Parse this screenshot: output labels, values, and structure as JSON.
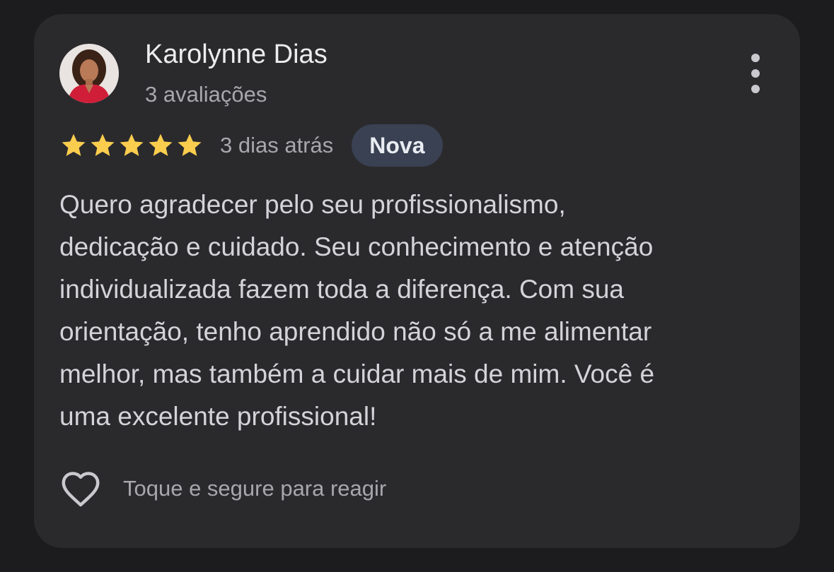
{
  "review": {
    "author_name": "Karolynne Dias",
    "review_count": "3 avaliações",
    "rating": 5,
    "rating_max": 5,
    "date": "3 dias atrás",
    "badge": "Nova",
    "text": "Quero agradecer pelo seu profissionalismo,\ndedicação e cuidado. Seu conhecimento e atenção\nindividualizada fazem toda a diferença. Com sua\norientação, tenho aprendido não só a me alimentar\nmelhor, mas também a cuidar mais de mim. Você é\numa excelente profissional!",
    "react_label": "Toque e segure para reagir"
  },
  "icons": {
    "avatar": "avatar-photo",
    "star": "star-icon",
    "more": "more-vert-icon",
    "heart": "heart-outline-icon"
  },
  "colors": {
    "background": "#1c1c1e",
    "card": "#2a2a2d",
    "star": "#fbcd4e",
    "badge": "#394152",
    "primary_text": "#ececef",
    "secondary_text": "#a7a7ac"
  }
}
